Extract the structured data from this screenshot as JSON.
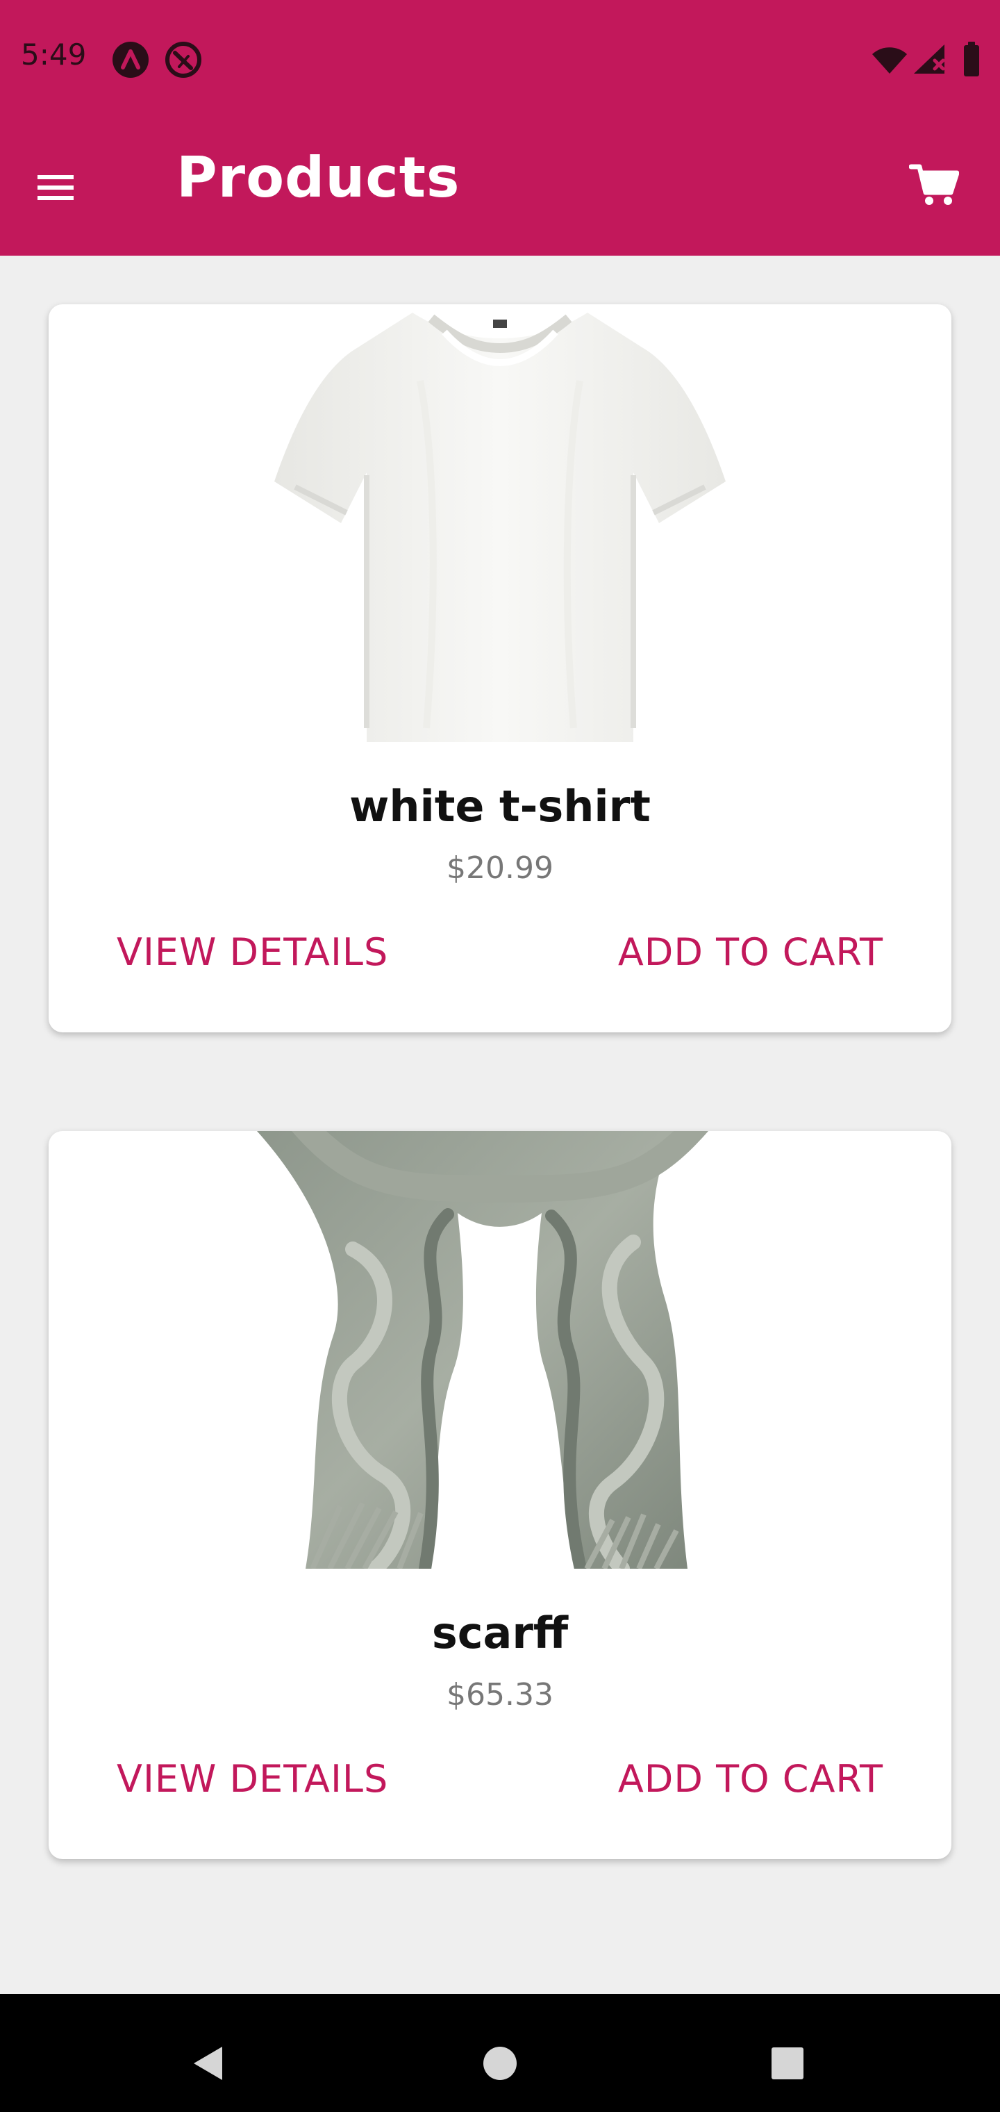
{
  "status_bar": {
    "time": "5:49"
  },
  "app_bar": {
    "title": "Products",
    "menu_icon": "menu-icon",
    "cart_icon": "shopping-cart-icon"
  },
  "products": [
    {
      "name": "white t-shirt",
      "price": "$20.99",
      "image_icon": "white-tshirt-image",
      "view_details_label": "VIEW DETAILS",
      "add_to_cart_label": "ADD TO CART"
    },
    {
      "name": "scarff",
      "price": "$65.33",
      "image_icon": "scarf-image",
      "view_details_label": "VIEW DETAILS",
      "add_to_cart_label": "ADD TO CART"
    }
  ],
  "navigation": {
    "back_icon": "back-icon",
    "home_icon": "home-icon",
    "recents_icon": "recents-icon"
  },
  "colors": {
    "primary": "#c2185b",
    "background": "#efefef",
    "card": "#ffffff",
    "title_text": "#111111",
    "price_text": "#777777",
    "navigation_bar": "#000000"
  }
}
